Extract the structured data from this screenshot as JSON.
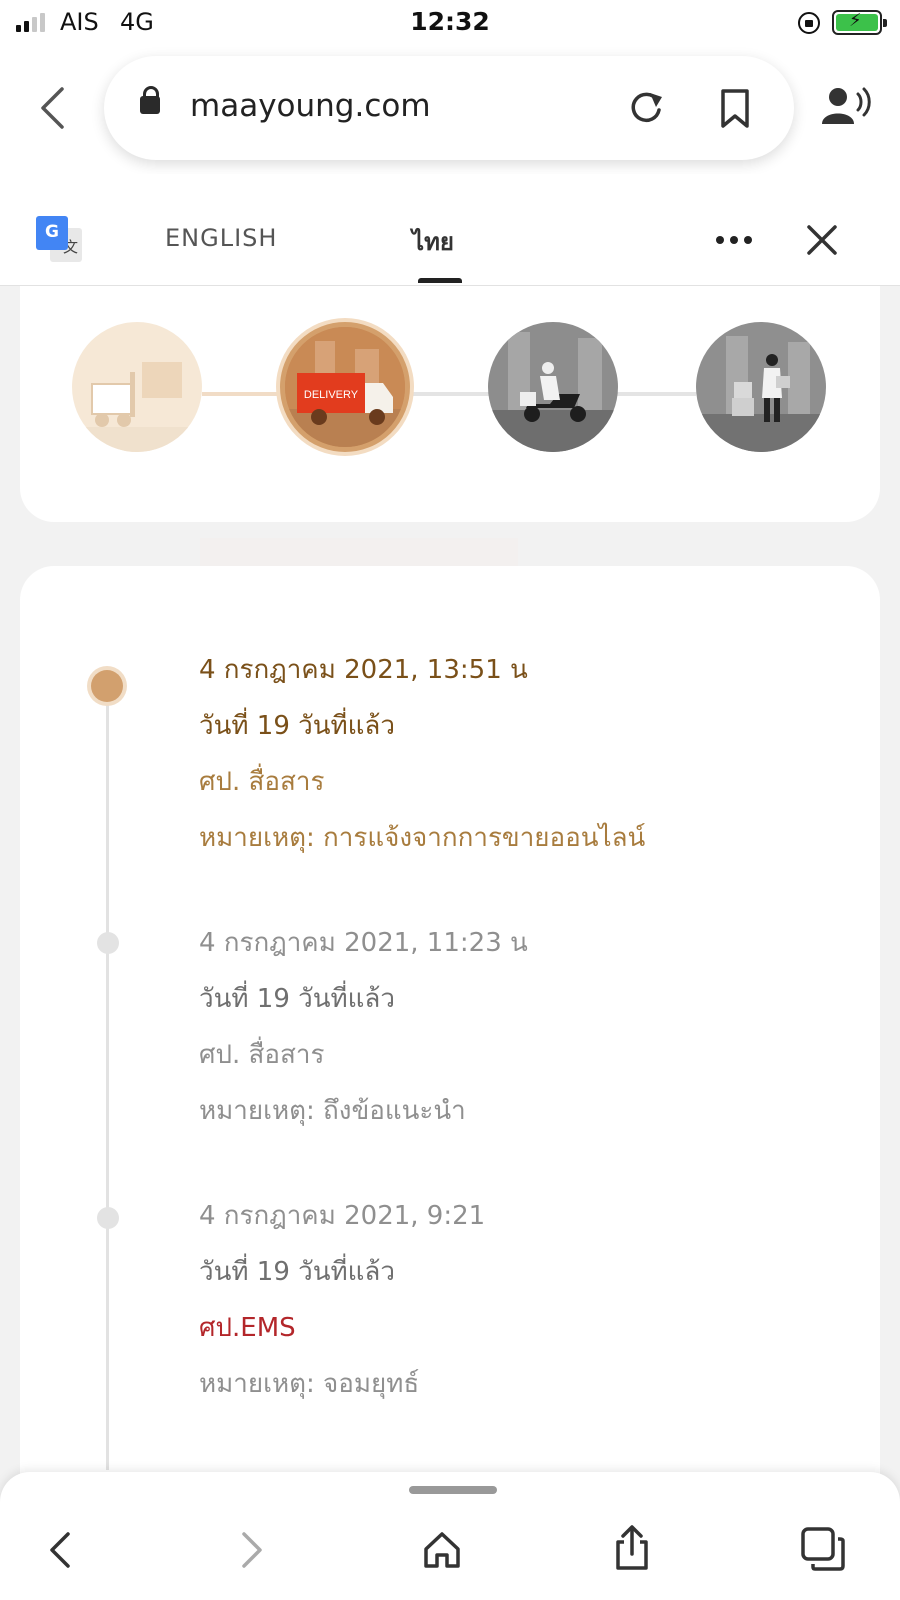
{
  "status_bar": {
    "carrier": "AIS",
    "network": "4G",
    "time": "12:32"
  },
  "browser": {
    "url": "maayoung.com"
  },
  "translate_bar": {
    "lang_english": "ENGLISH",
    "lang_thai": "ไทย",
    "selected": "ไทย"
  },
  "progress": {
    "steps": [
      {
        "icon": "forklift-icon",
        "label": "",
        "state": "done"
      },
      {
        "icon": "delivery-truck-icon",
        "label": "DELIVERY",
        "state": "current"
      },
      {
        "icon": "scooter-courier-icon",
        "label": "",
        "state": "pending"
      },
      {
        "icon": "parcel-received-icon",
        "label": "",
        "state": "pending"
      }
    ]
  },
  "timeline": [
    {
      "date": "4 กรกฎาคม 2021, 13:51 น",
      "days": "วันที่ 19 วันที่แล้ว",
      "location": "ศป. สื่อสาร",
      "note": "หมายเหตุ: การแจ้งจากการขายออนไลน์",
      "state": "active"
    },
    {
      "date": "4 กรกฎาคม 2021, 11:23 น",
      "days": "วันที่ 19 วันที่แล้ว",
      "location": "ศป. สื่อสาร",
      "note": "หมายเหตุ: ถึงข้อแนะนำ"
    },
    {
      "date": "4 กรกฎาคม 2021, 9:21",
      "days": "วันที่ 19 วันที่แล้ว",
      "location": "ศป.EMS",
      "note": "หมายเหตุ: จอมยุทธ์"
    }
  ],
  "colors": {
    "accent": "#d2a06e",
    "active_text": "#7a5019",
    "active_subtext": "#a87c3e",
    "ems_red": "#b3262a",
    "battery_green": "#3cc14a"
  }
}
